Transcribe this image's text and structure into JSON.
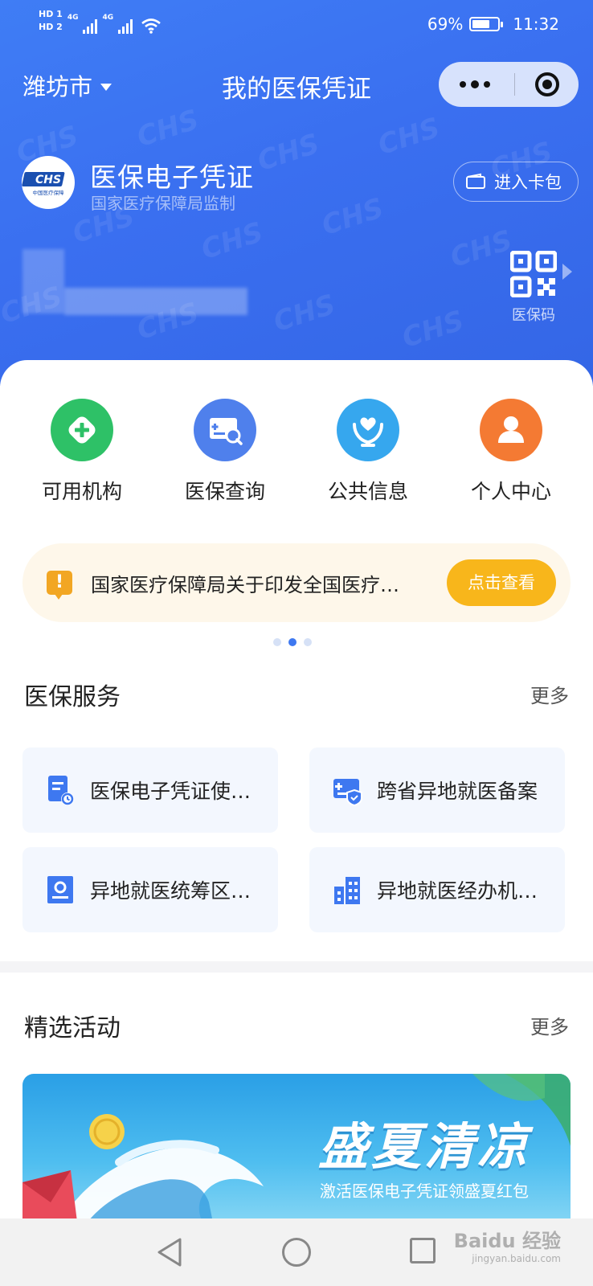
{
  "status_bar": {
    "network_badges": [
      "HD 1",
      "HD 2"
    ],
    "net_type_1": "4G",
    "net_type_2": "4G",
    "battery_text": "69%",
    "battery_level": 0.69,
    "time": "11:32"
  },
  "nav": {
    "city": "潍坊市",
    "title": "我的医保凭证"
  },
  "card": {
    "logo_text": "CHS",
    "logo_caption": "中国医疗保障",
    "title": "医保电子凭证",
    "subtitle": "国家医疗保障局监制",
    "wallet_button": "进入卡包",
    "qr_label": "医保码"
  },
  "quick_actions": [
    {
      "label": "可用机构",
      "icon": "hospital-plus-icon",
      "color": "#2ec167"
    },
    {
      "label": "医保查询",
      "icon": "card-search-icon",
      "color": "#4f80ec"
    },
    {
      "label": "公共信息",
      "icon": "heart-hands-icon",
      "color": "#36a7ee"
    },
    {
      "label": "个人中心",
      "icon": "person-icon",
      "color": "#f47a33"
    }
  ],
  "notice": {
    "text": "国家医疗保障局关于印发全国医疗…",
    "button": "点击查看",
    "pages": 3,
    "active_page": 2
  },
  "services": {
    "title": "医保服务",
    "more": "更多",
    "items": [
      {
        "label": "医保电子凭证使…",
        "icon": "document-clock-icon"
      },
      {
        "label": "跨省异地就医备案",
        "icon": "card-shield-icon"
      },
      {
        "label": "异地就医统筹区…",
        "icon": "contact-card-icon"
      },
      {
        "label": "异地就医经办机…",
        "icon": "building-icon"
      }
    ]
  },
  "activities": {
    "title": "精选活动",
    "more": "更多",
    "banner_title": "盛夏清凉",
    "banner_sub": "激活医保电子凭证领盛夏红包"
  },
  "watermark": {
    "brand": "Baidu",
    "brand_cn": "经验",
    "site": "jingyan.baidu.com"
  },
  "colors": {
    "header_blue": "#3a6ff0",
    "accent_blue": "#3e78f0",
    "notice_bg": "#fef7ea",
    "notice_button": "#f8b61b",
    "service_bg": "#f3f7fe"
  }
}
